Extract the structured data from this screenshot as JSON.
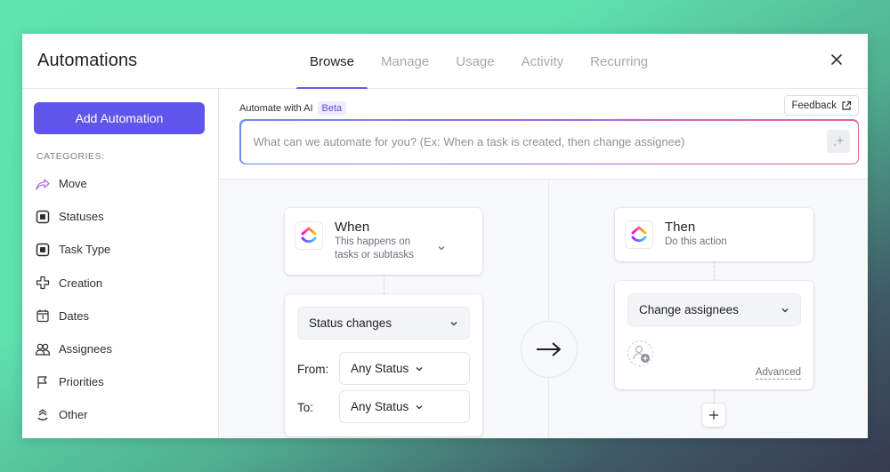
{
  "header": {
    "title": "Automations",
    "tabs": [
      {
        "label": "Browse",
        "active": true
      },
      {
        "label": "Manage",
        "active": false
      },
      {
        "label": "Usage",
        "active": false
      },
      {
        "label": "Activity",
        "active": false
      },
      {
        "label": "Recurring",
        "active": false
      }
    ],
    "close_icon": "close-icon"
  },
  "sidebar": {
    "add_button_label": "Add Automation",
    "categories_label": "CATEGORIES:",
    "categories": [
      {
        "label": "Move",
        "icon": "move-arrow-icon"
      },
      {
        "label": "Statuses",
        "icon": "status-square-icon"
      },
      {
        "label": "Task Type",
        "icon": "task-type-square-icon"
      },
      {
        "label": "Creation",
        "icon": "plus-outline-icon"
      },
      {
        "label": "Dates",
        "icon": "calendar-icon"
      },
      {
        "label": "Assignees",
        "icon": "users-icon"
      },
      {
        "label": "Priorities",
        "icon": "flag-icon"
      },
      {
        "label": "Other",
        "icon": "other-chevrons-icon"
      }
    ]
  },
  "ai": {
    "label": "Automate with AI",
    "badge": "Beta",
    "feedback_label": "Feedback",
    "placeholder": "What can we automate for you? (Ex: When a task is created, then change assignee)",
    "value": ""
  },
  "trigger": {
    "title": "When",
    "subtitle_line1": "This happens on",
    "subtitle_line2": "tasks or subtasks",
    "event": "Status changes",
    "from_label": "From:",
    "from_value": "Any Status",
    "to_label": "To:",
    "to_value": "Any Status"
  },
  "action": {
    "title": "Then",
    "subtitle": "Do this action",
    "action_value": "Change assignees",
    "advanced_label": "Advanced",
    "add_step_label": "+"
  },
  "colors": {
    "accent": "#6055eb",
    "tab_indicator": "#6b5de8",
    "beta_bg": "#eeecfd"
  }
}
